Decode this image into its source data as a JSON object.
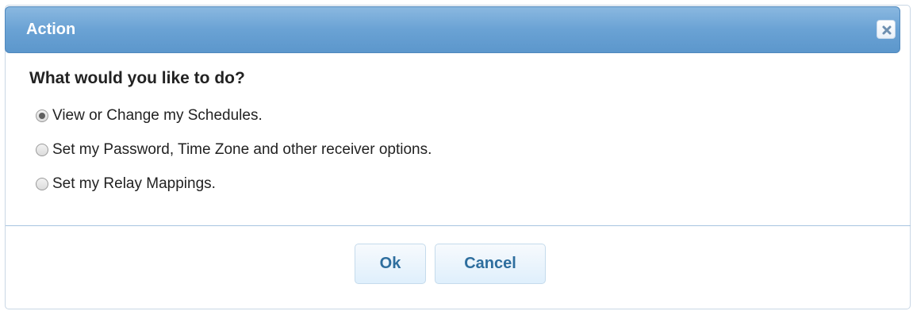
{
  "dialog": {
    "title": "Action",
    "close_icon": "close-icon",
    "question": "What would you like to do?",
    "options": [
      {
        "label": "View or Change my Schedules.",
        "checked": true
      },
      {
        "label": "Set my Password, Time Zone and other receiver options.",
        "checked": false
      },
      {
        "label": "Set my Relay Mappings.",
        "checked": false
      }
    ],
    "buttons": {
      "ok": "Ok",
      "cancel": "Cancel"
    }
  },
  "colors": {
    "titlebar": "#6aa2d4",
    "button_text": "#2e6e9e",
    "divider": "#a7c4e0"
  }
}
